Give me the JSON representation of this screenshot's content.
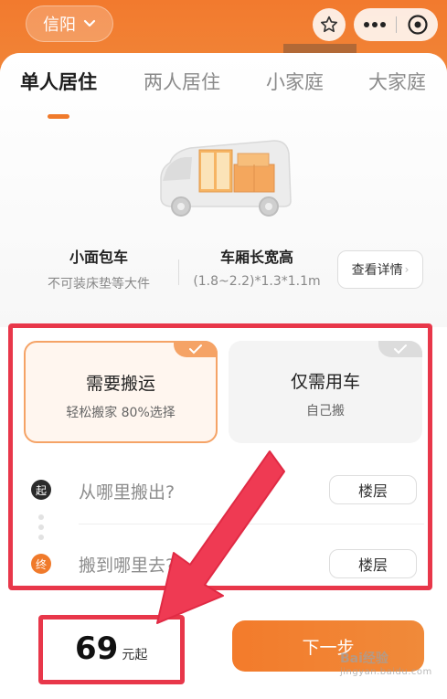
{
  "header": {
    "city": "信阳",
    "icons": {
      "city_dropdown": "chevron-down-icon",
      "favorite": "star-icon",
      "more": "more-icon",
      "close": "close-icon"
    },
    "accent": "#f07a2b"
  },
  "tabs": [
    {
      "label": "单人居住",
      "active": true
    },
    {
      "label": "两人居住",
      "active": false
    },
    {
      "label": "小家庭",
      "active": false
    },
    {
      "label": "大家庭",
      "active": false
    }
  ],
  "vehicle": {
    "name": "小面包车",
    "name_note": "不可装床垫等大件",
    "dims_title": "车厢长宽高",
    "dims_value": "(1.8~2.2)*1.3*1.1m",
    "detail_label": "查看详情"
  },
  "options": [
    {
      "title": "需要搬运",
      "subtitle": "轻松搬家 80%选择",
      "selected": true
    },
    {
      "title": "仅需用车",
      "subtitle": "自己搬",
      "selected": false
    }
  ],
  "address": {
    "start_marker": "起",
    "start_placeholder": "从哪里搬出?",
    "end_marker": "终",
    "end_placeholder": "搬到哪里去?",
    "floor_label": "楼层"
  },
  "footer": {
    "price": "69",
    "price_unit": "元起",
    "next_label": "下一步"
  },
  "watermark": {
    "line1": "Bai经验",
    "line2": "jingyan.baidu.com"
  },
  "colors": {
    "primary": "#f07a2b",
    "annotation": "#e8374a"
  }
}
